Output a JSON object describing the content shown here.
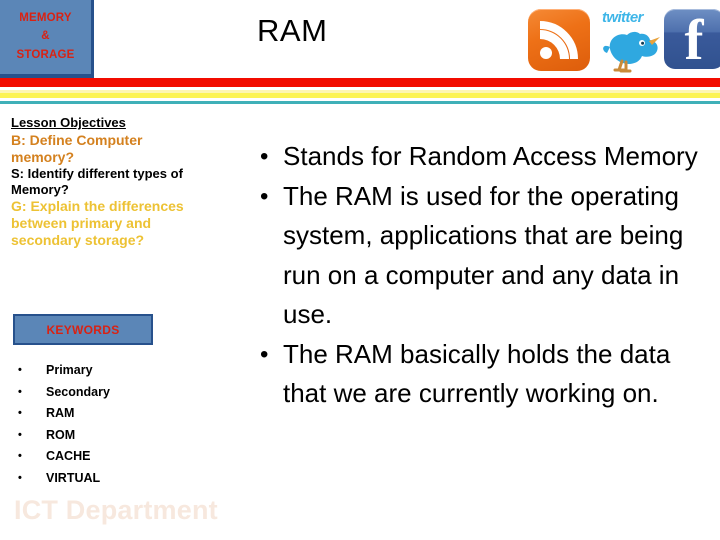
{
  "header": {
    "badge_lines": [
      "MEMORY",
      "&",
      "STORAGE"
    ],
    "title": "RAM",
    "badge_bg": "#5b86b7",
    "badge_border": "#27518c",
    "badge_text_color": "#d92213"
  },
  "social": {
    "rss": {
      "name": "rss-icon",
      "color": "#ee7117"
    },
    "twitter": {
      "name": "twitter-icon",
      "wordmark": "twitter",
      "color": "#3fb6e8"
    },
    "facebook": {
      "name": "facebook-icon",
      "letter": "f",
      "color": "#3a5a9b"
    }
  },
  "stripes": {
    "red": "#f20c00",
    "yellow_light": "#fdf6b2",
    "yellow": "#fcf453",
    "teal": "#3fb0b8"
  },
  "sidebar": {
    "objectives_heading": "Lesson Objectives",
    "objectives": [
      {
        "text": "B: Define Computer memory?",
        "level": "b",
        "color": "#d4811f"
      },
      {
        "text": "S: Identify different types of Memory?",
        "level": "s",
        "color": "#000000"
      },
      {
        "text": "G: Explain the differences between primary and secondary storage?",
        "level": "g",
        "color": "#edc234"
      }
    ],
    "keywords_title": "KEYWORDS",
    "keywords": [
      "Primary",
      "Secondary",
      "RAM",
      "ROM",
      "CACHE",
      "VIRTUAL"
    ],
    "department": "ICT Department"
  },
  "main": {
    "bullets": [
      "Stands for Random Access Memory",
      "The RAM is used for the operating system, applications that are being run on a computer and any data in use.",
      "The RAM basically holds the data that we are currently working on."
    ]
  }
}
